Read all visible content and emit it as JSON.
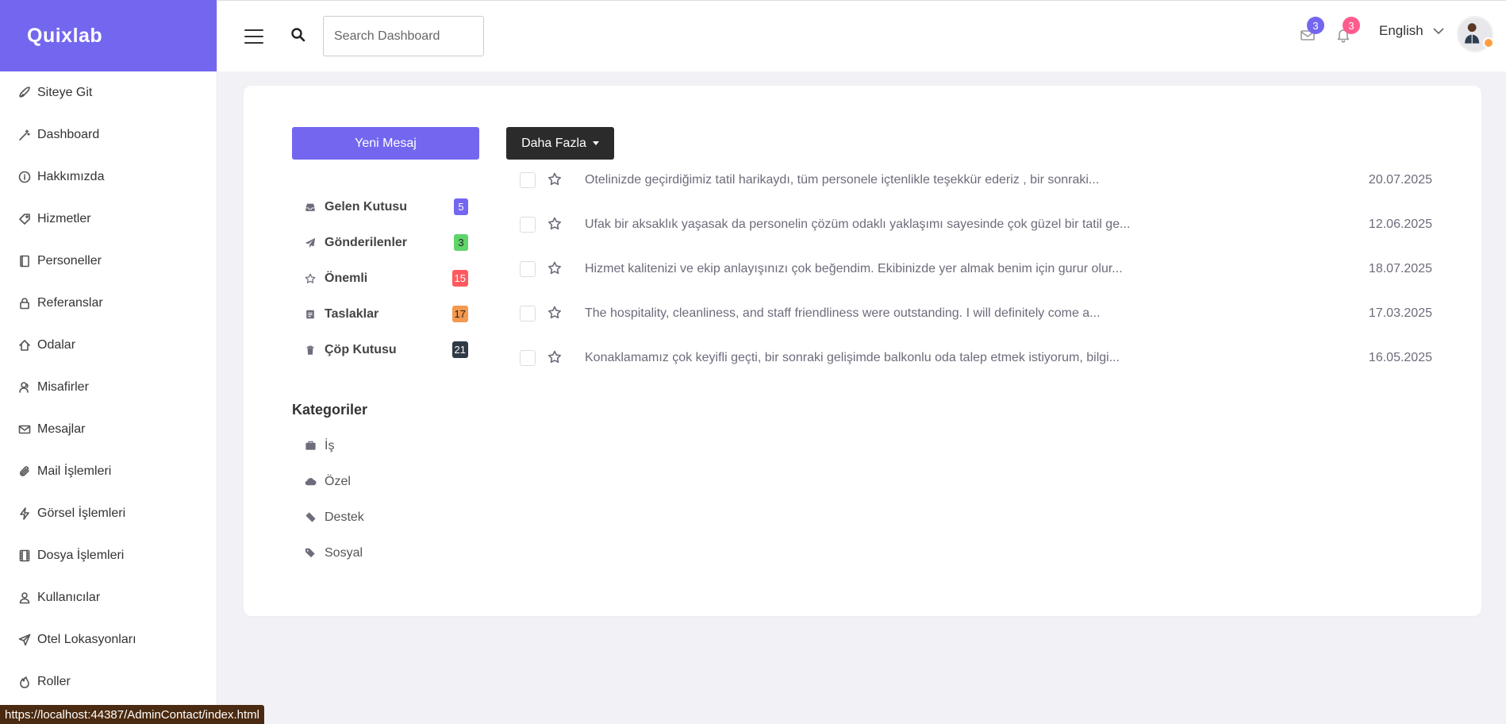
{
  "brand": "Quixlab",
  "sidebar": {
    "items": [
      {
        "label": "Siteye Git",
        "icon": "rocket-icon"
      },
      {
        "label": "Dashboard",
        "icon": "magic-wand-icon"
      },
      {
        "label": "Hakkımızda",
        "icon": "info-icon"
      },
      {
        "label": "Hizmetler",
        "icon": "tag-icon"
      },
      {
        "label": "Personeller",
        "icon": "book-icon"
      },
      {
        "label": "Referanslar",
        "icon": "lock-icon"
      },
      {
        "label": "Odalar",
        "icon": "home-icon"
      },
      {
        "label": "Misafirler",
        "icon": "users-icon"
      },
      {
        "label": "Mesajlar",
        "icon": "envelope-icon"
      },
      {
        "label": "Mail İşlemleri",
        "icon": "paperclip-icon"
      },
      {
        "label": "Görsel İşlemleri",
        "icon": "lightning-icon"
      },
      {
        "label": "Dosya İşlemleri",
        "icon": "film-icon"
      },
      {
        "label": "Kullanıcılar",
        "icon": "user-icon"
      },
      {
        "label": "Otel Lokasyonları",
        "icon": "send-icon"
      },
      {
        "label": "Roller",
        "icon": "fire-icon"
      }
    ]
  },
  "topbar": {
    "search_placeholder": "Search Dashboard",
    "mail_badge": "3",
    "notification_badge": "3",
    "language": "English"
  },
  "colors": {
    "accent": "#7367f0",
    "badge_mail": "#7367f0",
    "badge_notify": "#ff5c8d"
  },
  "mailbox": {
    "new_message_label": "Yeni Mesaj",
    "more_label": "Daha Fazla",
    "folders": [
      {
        "label": "Gelen Kutusu",
        "count": "5",
        "icon": "inbox-icon",
        "color": "#7367f0"
      },
      {
        "label": "Gönderilenler",
        "count": "3",
        "icon": "paper-plane-icon",
        "color": "#5fd46a"
      },
      {
        "label": "Önemli",
        "count": "15",
        "icon": "star-icon",
        "color": "#ff5a5f"
      },
      {
        "label": "Taslaklar",
        "count": "17",
        "icon": "file-icon",
        "color": "#f4994d"
      },
      {
        "label": "Çöp Kutusu",
        "count": "21",
        "icon": "trash-icon",
        "color": "#2f3a46"
      }
    ],
    "categories_title": "Kategoriler",
    "categories": [
      {
        "label": "İş",
        "icon": "briefcase-icon"
      },
      {
        "label": "Özel",
        "icon": "cloud-icon"
      },
      {
        "label": "Destek",
        "icon": "ticket-icon"
      },
      {
        "label": "Sosyal",
        "icon": "tags-icon"
      }
    ],
    "messages": [
      {
        "subject": "Otelinizde geçirdiğimiz tatil harikaydı, tüm personele içtenlikle teşekkür ederiz , bir sonraki...",
        "date": "20.07.2025"
      },
      {
        "subject": "Ufak bir aksaklık yaşasak da personelin çözüm odaklı yaklaşımı sayesinde çok güzel bir tatil ge...",
        "date": "12.06.2025"
      },
      {
        "subject": "Hizmet kalitenizi ve ekip anlayışınızı çok beğendim. Ekibinizde yer almak benim için gurur olur...",
        "date": "18.07.2025"
      },
      {
        "subject": "The hospitality, cleanliness, and staff friendliness were outstanding. I will definitely come a...",
        "date": "17.03.2025"
      },
      {
        "subject": "Konaklamamız çok keyifli geçti, bir sonraki gelişimde balkonlu oda talep etmek istiyorum, bilgi...",
        "date": "16.05.2025"
      }
    ]
  },
  "status_url": "https://localhost:44387/AdminContact/index.html"
}
